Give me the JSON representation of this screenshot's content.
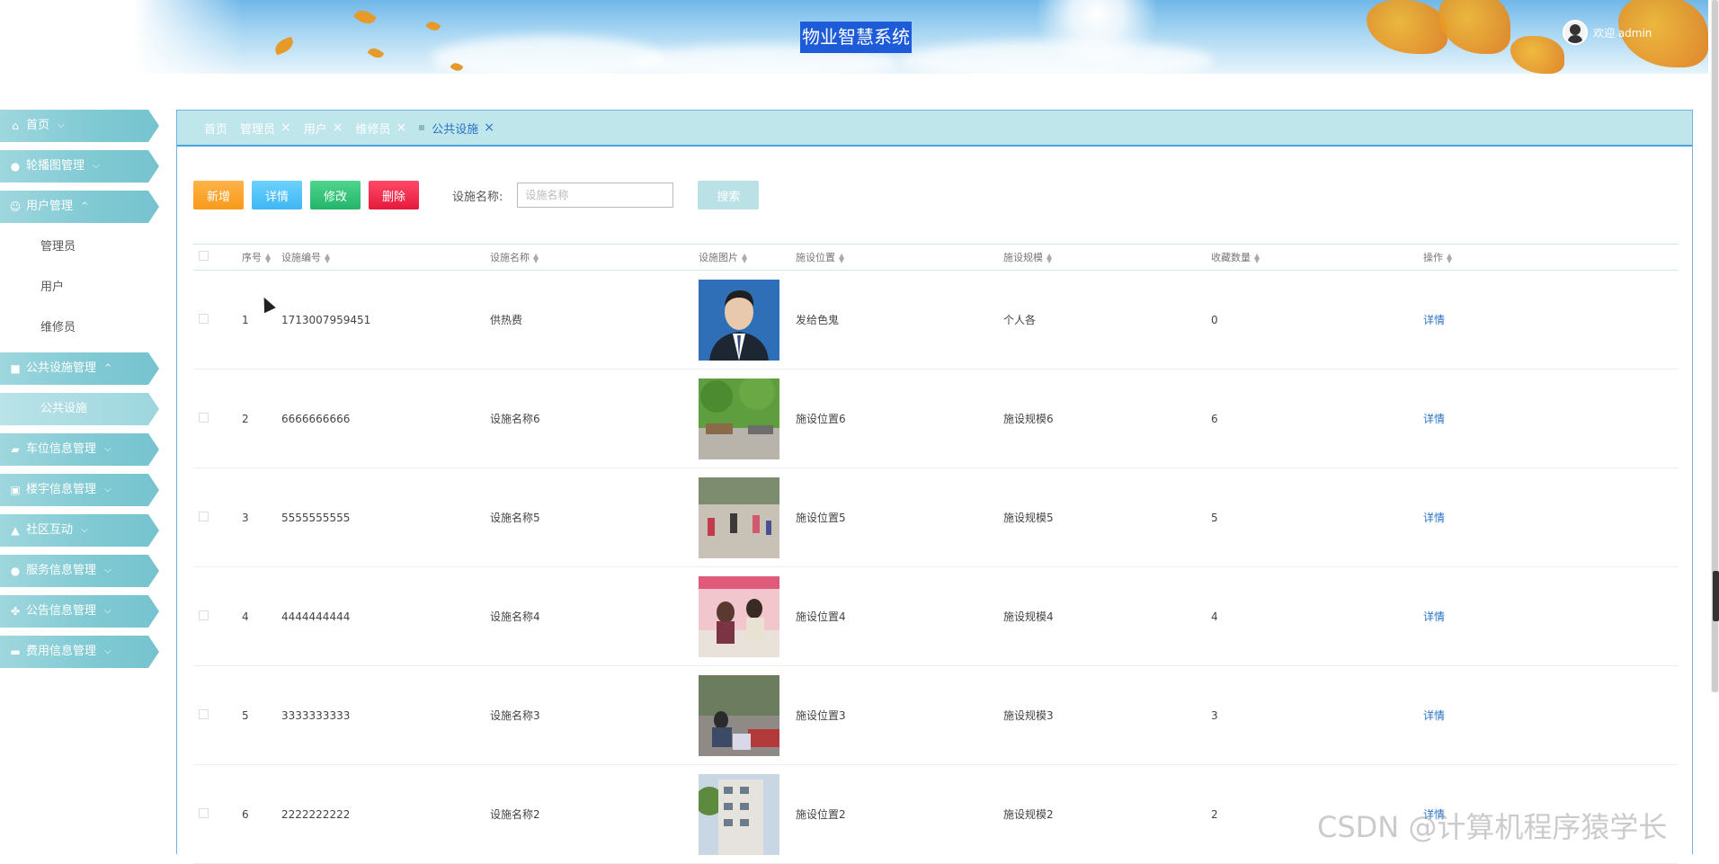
{
  "header": {
    "title": "物业智慧系统",
    "welcome": "欢迎 admin"
  },
  "sidebar": {
    "items": [
      {
        "label": "首页",
        "icon": "home-icon"
      },
      {
        "label": "轮播图管理",
        "icon": "image-icon"
      },
      {
        "label": "用户管理",
        "icon": "user-icon",
        "expanded": true,
        "children": [
          "管理员",
          "用户",
          "维修员"
        ]
      },
      {
        "label": "公共设施管理",
        "icon": "building-icon",
        "expanded": true,
        "children": [
          "公共设施"
        ]
      },
      {
        "label": "车位信息管理",
        "icon": "car-icon"
      },
      {
        "label": "楼宇信息管理",
        "icon": "floor-icon"
      },
      {
        "label": "社区互动",
        "icon": "thumbs-up-icon"
      },
      {
        "label": "服务信息管理",
        "icon": "service-icon"
      },
      {
        "label": "公告信息管理",
        "icon": "notice-icon"
      },
      {
        "label": "费用信息管理",
        "icon": "fee-icon"
      }
    ]
  },
  "tabs": [
    {
      "label": "首页",
      "closable": false
    },
    {
      "label": "管理员",
      "closable": true
    },
    {
      "label": "用户",
      "closable": true
    },
    {
      "label": "维修员",
      "closable": true
    },
    {
      "label": "公共设施",
      "closable": true,
      "active": true
    }
  ],
  "toolbar": {
    "add_label": "新增",
    "detail_label": "详情",
    "edit_label": "修改",
    "delete_label": "删除",
    "search_label": "设施名称:",
    "search_placeholder": "设施名称",
    "search_button": "搜索"
  },
  "table": {
    "columns": [
      "序号",
      "设施编号",
      "设施名称",
      "设施图片",
      "施设位置",
      "施设规模",
      "收藏数量",
      "操作"
    ],
    "rows": [
      {
        "index": "1",
        "code": "1713007959451",
        "name": "供热费",
        "location": "发给色鬼",
        "scale": "个人各",
        "favorites": "0",
        "action": "详情",
        "image": "portrait"
      },
      {
        "index": "2",
        "code": "6666666666",
        "name": "设施名称6",
        "location": "施设位置6",
        "scale": "施设规模6",
        "favorites": "6",
        "action": "详情",
        "image": "park"
      },
      {
        "index": "3",
        "code": "5555555555",
        "name": "设施名称5",
        "location": "施设位置5",
        "scale": "施设规模5",
        "favorites": "5",
        "action": "详情",
        "image": "square"
      },
      {
        "index": "4",
        "code": "4444444444",
        "name": "设施名称4",
        "location": "施设位置4",
        "scale": "施设规模4",
        "favorites": "4",
        "action": "详情",
        "image": "event"
      },
      {
        "index": "5",
        "code": "3333333333",
        "name": "设施名称3",
        "location": "施设位置3",
        "scale": "施设规模3",
        "favorites": "3",
        "action": "详情",
        "image": "street"
      },
      {
        "index": "6",
        "code": "2222222222",
        "name": "设施名称2",
        "location": "施设位置2",
        "scale": "施设规模2",
        "favorites": "2",
        "action": "详情",
        "image": "building"
      }
    ]
  },
  "watermark": "CSDN @计算机程序猿学长",
  "colors": {
    "accent": "#2a72c4",
    "menu": "#7fc9d3",
    "add": "#f79a1c",
    "detail": "#3fb6f3",
    "edit": "#22b56a",
    "delete": "#e5193c"
  }
}
